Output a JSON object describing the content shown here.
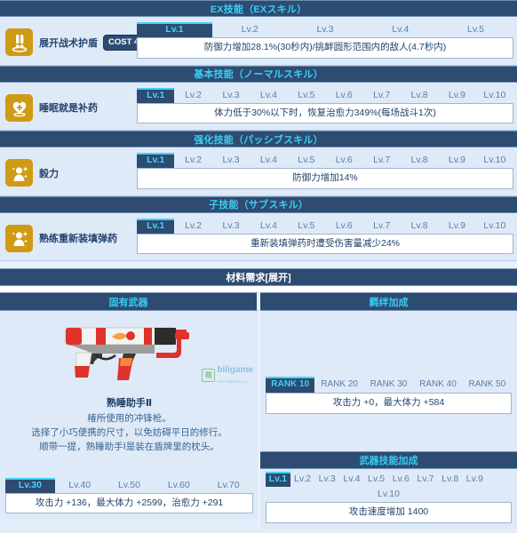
{
  "sections": [
    {
      "id": "ex",
      "title": "EX技能（EXスキル）",
      "skill": {
        "name": "展开战术护盾",
        "cost": "COST 4",
        "icon": "shield-exclamation-icon",
        "levels": [
          "Lv.1",
          "Lv.2",
          "Lv.3",
          "Lv.4",
          "Lv.5"
        ],
        "active_level": "Lv.1",
        "description": "防御力增加28.1%(30秒内)/挑衅圆形范围内的敌人(4.7秒内)"
      }
    },
    {
      "id": "normal",
      "title": "基本技能（ノーマルスキル）",
      "skill": {
        "name": "睡眠就是补药",
        "cost": "",
        "icon": "heart-plus-icon",
        "levels": [
          "Lv.1",
          "Lv.2",
          "Lv.3",
          "Lv.4",
          "Lv.5",
          "Lv.6",
          "Lv.7",
          "Lv.8",
          "Lv.9",
          "Lv.10"
        ],
        "active_level": "Lv.1",
        "description": "体力低于30%以下时，恢复治愈力349%(每场战斗1次)"
      }
    },
    {
      "id": "passive",
      "title": "强化技能（パッシブスキル）",
      "skill": {
        "name": "毅力",
        "cost": "",
        "icon": "character-sparkle-icon",
        "levels": [
          "Lv.1",
          "Lv.2",
          "Lv.3",
          "Lv.4",
          "Lv.5",
          "Lv.6",
          "Lv.7",
          "Lv.8",
          "Lv.9",
          "Lv.10"
        ],
        "active_level": "Lv.1",
        "description": "防御力增加14%"
      }
    },
    {
      "id": "sub",
      "title": "子技能（サブスキル）",
      "skill": {
        "name": "熟练重新装填弹药",
        "cost": "",
        "icon": "character-sparkle-icon",
        "levels": [
          "Lv.1",
          "Lv.2",
          "Lv.3",
          "Lv.4",
          "Lv.5",
          "Lv.6",
          "Lv.7",
          "Lv.8",
          "Lv.9",
          "Lv.10"
        ],
        "active_level": "Lv.1",
        "description": "重新装填弹药时遭受伤害量减少24%"
      }
    }
  ],
  "materials": {
    "title": "材料需求",
    "toggle_label": "[展开]"
  },
  "weapon": {
    "column_header": "固有武器",
    "name": "熟睡助手Ⅱ",
    "description_lines": [
      "椿所使用的冲锋枪。",
      "选择了小巧便携的尺寸，以免妨碍平日的修行。",
      "顺带一提，熟睡助手Ⅰ是装在盾牌里的枕头。"
    ],
    "levels": [
      "Lv.30",
      "Lv.40",
      "Lv.50",
      "Lv.60",
      "Lv.70"
    ],
    "active_level": "Lv.30",
    "stats": "攻击力 +136，最大体力 +2599，治愈力 +291",
    "watermark": {
      "mark": "萌",
      "title": "biligame",
      "sub": "wiki.biligame.com"
    }
  },
  "bond": {
    "column_header": "羁绊加成",
    "ranks": [
      "RANK 10",
      "RANK 20",
      "RANK 30",
      "RANK 40",
      "RANK 50"
    ],
    "active_rank": "RANK 10",
    "stats": "攻击力 +0，最大体力 +584"
  },
  "weapon_skill": {
    "title": "武器技能加成",
    "levels": [
      "Lv.1",
      "Lv.2",
      "Lv.3",
      "Lv.4",
      "Lv.5",
      "Lv.6",
      "Lv.7",
      "Lv.8",
      "Lv.9",
      "Lv.10"
    ],
    "active_level": "Lv.1",
    "stats": "攻击速度增加 1400"
  },
  "colors": {
    "bar_navy": "#2e4b72",
    "accent_cyan": "#39d0f3",
    "icon_gold": "#cf9a14",
    "page_bg": "#dfeaf8"
  }
}
